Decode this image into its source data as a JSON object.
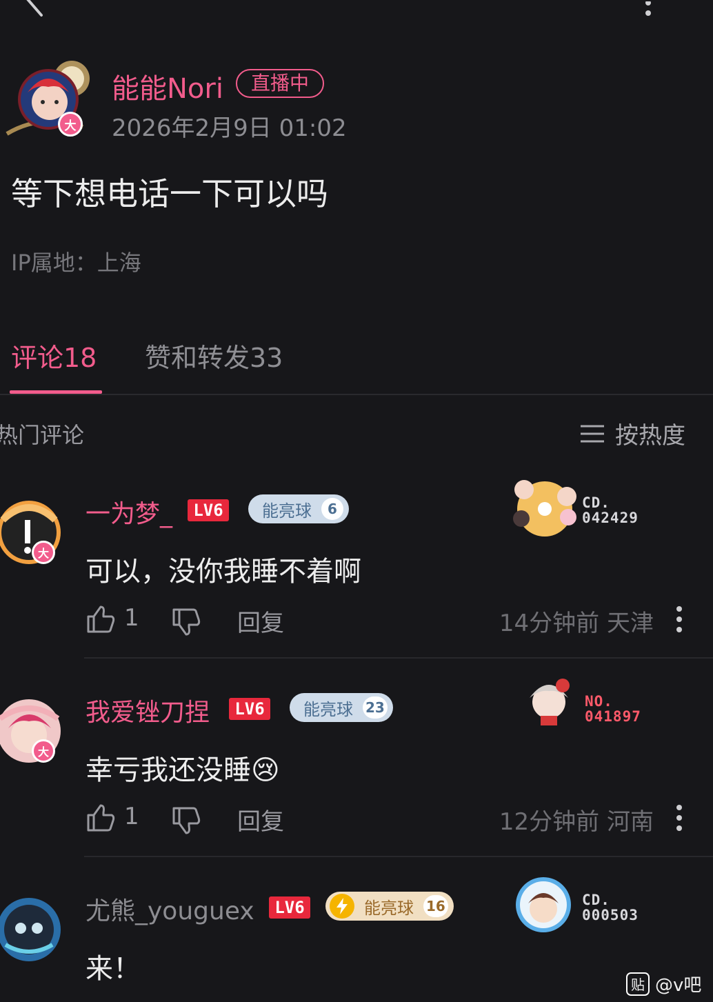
{
  "post": {
    "author": "能能Nori",
    "live_badge": "直播中",
    "time": "2026年2月9日 01:02",
    "content": "等下想电话一下可以吗",
    "ip_location": "IP属地：上海",
    "avatar_badge": "大"
  },
  "tabs": [
    {
      "label": "评论18",
      "active": true
    },
    {
      "label": "赞和转发33",
      "active": false
    }
  ],
  "section": {
    "hot_label": "热门评论",
    "sort_label": "按热度"
  },
  "comments": [
    {
      "name": "一为梦_",
      "level": "LV6",
      "fan_label": "能亮球",
      "fan_level": "6",
      "text": "可以，没你我睡不着啊",
      "likes": "1",
      "reply_label": "回复",
      "meta": "14分钟前 天津",
      "deco_code": "CD.\n042429",
      "avatar_badge": "大"
    },
    {
      "name": "我爱锉刀捏",
      "level": "LV6",
      "fan_label": "能亮球",
      "fan_level": "23",
      "text": "幸亏我还没睡",
      "emoji": "😢",
      "likes": "1",
      "reply_label": "回复",
      "meta": "12分钟前 河南",
      "deco_code": "NO.\n041897",
      "avatar_badge": "大"
    },
    {
      "name": "尤熊_youguex",
      "level": "LV6",
      "fan_label": "能亮球",
      "fan_level": "16",
      "text": "来！",
      "deco_code": "CD.\n000503"
    }
  ],
  "watermark": {
    "icon_text": "贴",
    "label": "@v吧"
  },
  "colors": {
    "background": "#17171a",
    "accent": "#f25c8c",
    "level_badge": "#e8283c"
  }
}
